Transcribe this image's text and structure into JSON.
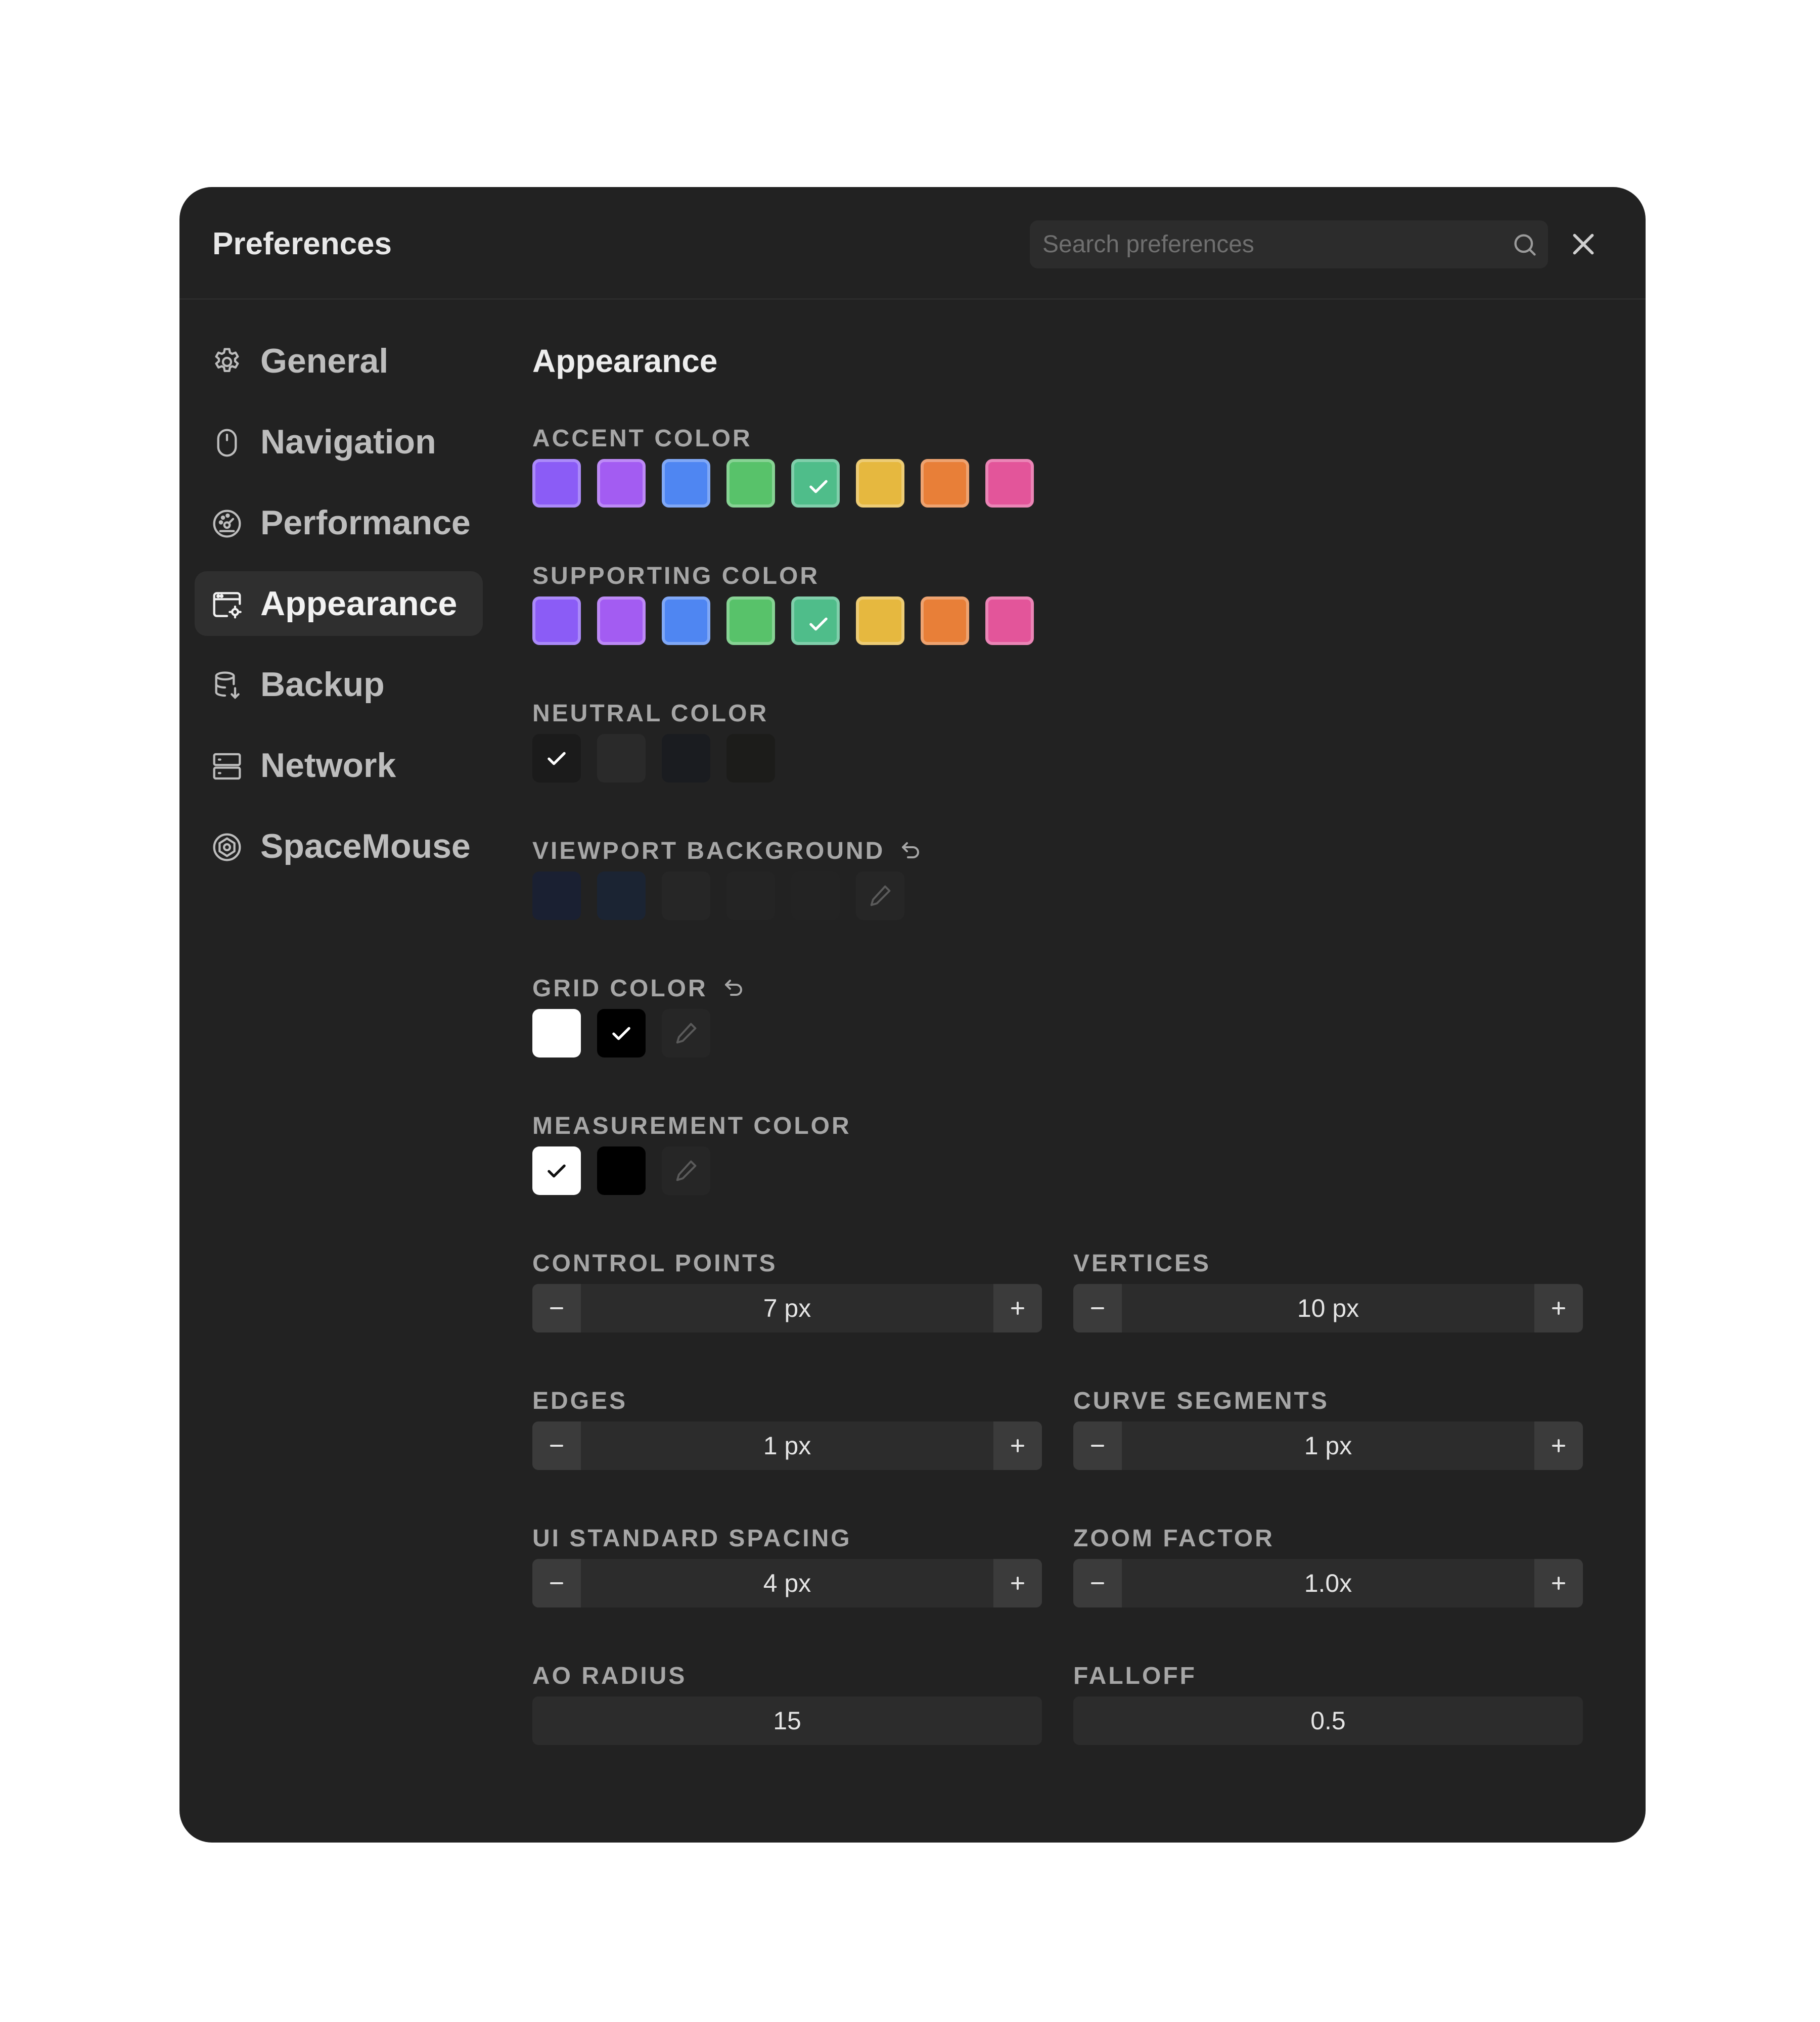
{
  "dialog": {
    "title": "Preferences",
    "search_placeholder": "Search preferences"
  },
  "sidebar": {
    "items": [
      {
        "label": "General",
        "icon": "gear-icon"
      },
      {
        "label": "Navigation",
        "icon": "mouse-icon"
      },
      {
        "label": "Performance",
        "icon": "dashboard-icon"
      },
      {
        "label": "Appearance",
        "icon": "window-settings-icon",
        "active": true
      },
      {
        "label": "Backup",
        "icon": "database-icon"
      },
      {
        "label": "Network",
        "icon": "server-icon"
      },
      {
        "label": "SpaceMouse",
        "icon": "spacemouse-icon"
      }
    ]
  },
  "content": {
    "title": "Appearance",
    "accent_color": {
      "label": "ACCENT COLOR",
      "swatches": [
        "#8b5cf6",
        "#a35cf2",
        "#4f86f2",
        "#58c26a",
        "#4fbd8a",
        "#e6b83f",
        "#e87f38",
        "#e3559a"
      ],
      "selected_index": 4
    },
    "supporting_color": {
      "label": "SUPPORTING COLOR",
      "swatches": [
        "#8b5cf6",
        "#a35cf2",
        "#4f86f2",
        "#58c26a",
        "#4fbd8a",
        "#e6b83f",
        "#e87f38",
        "#e3559a"
      ],
      "selected_index": 4
    },
    "neutral_color": {
      "label": "NEUTRAL COLOR",
      "swatches": [
        "#1b1b1b",
        "#2a2a2a",
        "#1a1c20",
        "#1c1c1a"
      ],
      "selected_index": 0
    },
    "viewport_background": {
      "label": "VIEWPORT BACKGROUND",
      "swatches": [
        "#1a2032",
        "#1b2433",
        "#262626",
        "#242424",
        "#232323"
      ]
    },
    "grid_color": {
      "label": "GRID COLOR",
      "swatches": [
        "#ffffff",
        "#000000"
      ],
      "selected_index": 1
    },
    "measurement_color": {
      "label": "MEASUREMENT COLOR",
      "swatches": [
        "#ffffff",
        "#000000"
      ],
      "selected_index": 0
    },
    "steppers": {
      "control_points": {
        "label": "CONTROL POINTS",
        "value": "7 px"
      },
      "vertices": {
        "label": "VERTICES",
        "value": "10 px"
      },
      "edges": {
        "label": "EDGES",
        "value": "1 px"
      },
      "curve_segments": {
        "label": "CURVE SEGMENTS",
        "value": "1 px"
      },
      "ui_standard_spacing": {
        "label": "UI STANDARD SPACING",
        "value": "4 px"
      },
      "zoom_factor": {
        "label": "ZOOM FACTOR",
        "value": "1.0x"
      }
    },
    "fields": {
      "ao_radius": {
        "label": "AO RADIUS",
        "value": "15"
      },
      "falloff": {
        "label": "FALLOFF",
        "value": "0.5"
      }
    }
  }
}
